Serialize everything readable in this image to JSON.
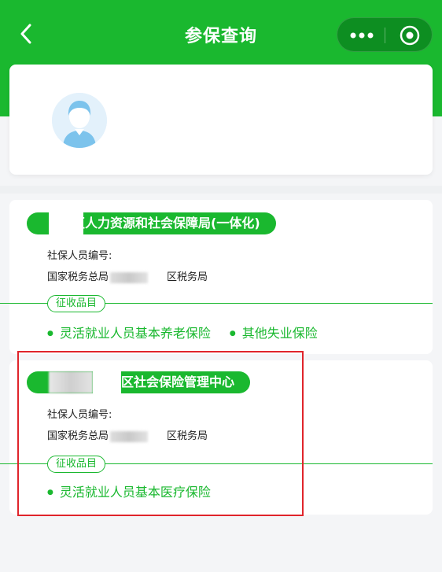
{
  "header": {
    "title": "参保查询"
  },
  "cards": [
    {
      "org_name": "区人力资源和社会保障局(一体化)",
      "id_label": "社保人员编号:",
      "tax_prefix": "国家税务总局",
      "tax_suffix": "区税务局",
      "zs_label": "征收品目",
      "items": [
        "灵活就业人员基本养老保险",
        "其他失业保险"
      ]
    },
    {
      "org_name": "区社会保险管理中心",
      "id_label": "社保人员编号:",
      "tax_prefix": "国家税务总局",
      "tax_suffix": "区税务局",
      "zs_label": "征收品目",
      "items": [
        "灵活就业人员基本医疗保险"
      ]
    }
  ],
  "colors": {
    "brand": "#1ab82f",
    "highlight": "#e0242b"
  },
  "icons": {
    "back": "chevron-left-icon",
    "more": "more-dots-icon",
    "close": "target-close-icon",
    "avatar": "user-avatar-icon"
  }
}
